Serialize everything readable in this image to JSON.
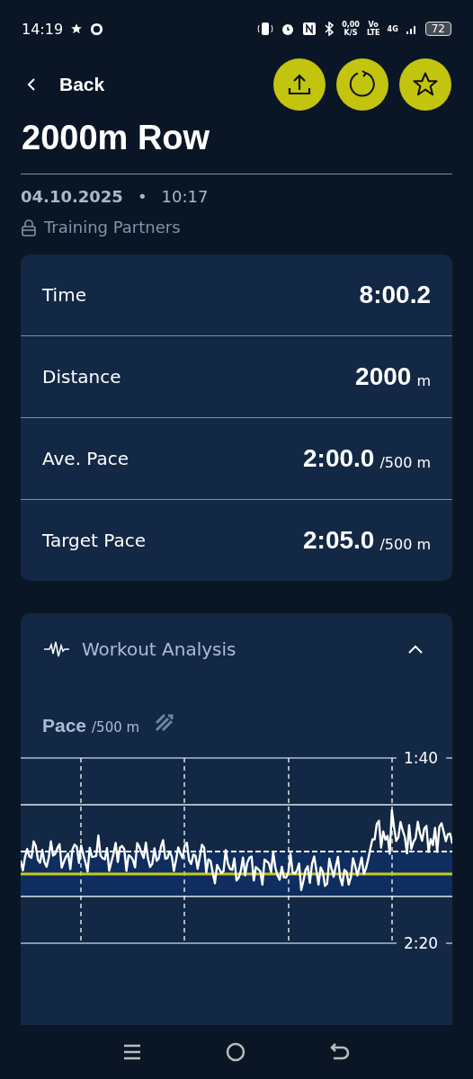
{
  "status_bar": {
    "time": "14:19",
    "speed": "0,00",
    "speed_unit": "K/S",
    "volte_top": "Vo",
    "volte_bottom": "LTE",
    "network": "4G",
    "battery": "72"
  },
  "header": {
    "back": "Back"
  },
  "title": "2000m Row",
  "date": "04.10.2025",
  "separator": "•",
  "time": "10:17",
  "visibility": "Training Partners",
  "stats": [
    {
      "label": "Time",
      "value": "8:00.2"
    },
    {
      "label": "Distance",
      "value": "2000",
      "unit": "m"
    },
    {
      "label": "Ave. Pace",
      "value": "2:00.0",
      "unit": "/500 m"
    },
    {
      "label": "Target Pace",
      "value": "2:05.0",
      "unit": "/500 m"
    }
  ],
  "analysis": {
    "title": "Workout Analysis",
    "expanded": true,
    "metric": "Pace",
    "metric_unit": "/500 m",
    "y_top_label": "1:40",
    "y_bottom_label": "2:20"
  }
}
